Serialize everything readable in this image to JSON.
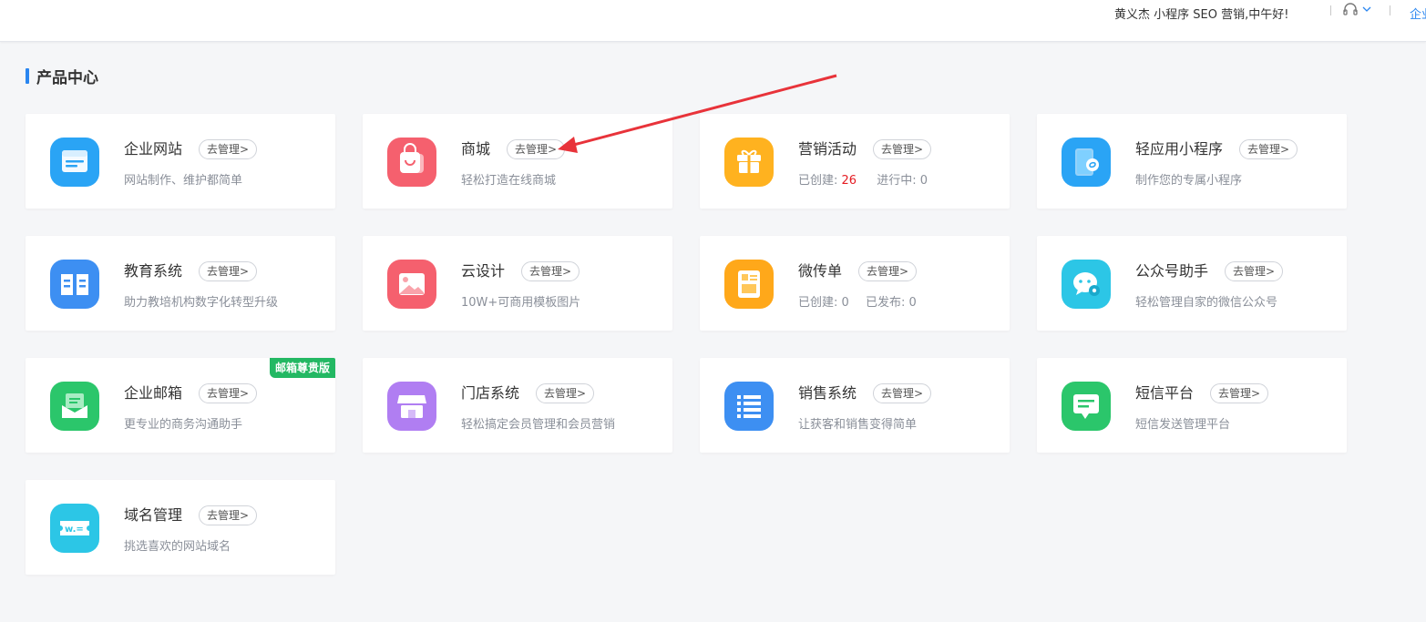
{
  "header": {
    "greeting": "黄义杰  小程序  SEO  营销,中午好!",
    "corp_link": "企业"
  },
  "section": {
    "title": "产品中心"
  },
  "cards": [
    {
      "name": "企业网站",
      "manage": "去管理>",
      "desc": "网站制作、维护都简单",
      "icon": "browser-window-icon",
      "color": "#2aa4f5"
    },
    {
      "name": "商城",
      "manage": "去管理>",
      "desc": "轻松打造在线商城",
      "icon": "shopping-bag-icon",
      "color": "#f5606e"
    },
    {
      "name": "营销活动",
      "manage": "去管理>",
      "stats": {
        "created_label": "已创建:",
        "created_value": "26",
        "active_label": "进行中:",
        "active_value": "0"
      },
      "icon": "gift-box-icon",
      "color": "#ffb21f"
    },
    {
      "name": "轻应用小程序",
      "manage": "去管理>",
      "desc": "制作您的专属小程序",
      "icon": "mini-program-phone-icon",
      "color": "#2aa4f5"
    },
    {
      "name": "教育系统",
      "manage": "去管理>",
      "desc": "助力教培机构数字化转型升级",
      "icon": "open-book-icon",
      "color": "#3d8ff2"
    },
    {
      "name": "云设计",
      "manage": "去管理>",
      "desc": "10W+可商用模板图片",
      "icon": "image-icon",
      "color": "#f5606e"
    },
    {
      "name": "微传单",
      "manage": "去管理>",
      "stats": {
        "created_label": "已创建:",
        "created_value": "0",
        "active_label": "已发布:",
        "active_value": "0"
      },
      "icon": "flyer-icon",
      "color": "#ffa81a"
    },
    {
      "name": "公众号助手",
      "manage": "去管理>",
      "desc": "轻松管理自家的微信公众号",
      "icon": "wechat-gear-icon",
      "color": "#2cc6e6"
    },
    {
      "name": "企业邮箱",
      "manage": "去管理>",
      "desc": "更专业的商务沟通助手",
      "badge": "邮箱尊贵版",
      "icon": "mail-envelope-icon",
      "color": "#2bc66b"
    },
    {
      "name": "门店系统",
      "manage": "去管理>",
      "desc": "轻松搞定会员管理和会员营销",
      "icon": "storefront-icon",
      "color": "#b07ef2"
    },
    {
      "name": "销售系统",
      "manage": "去管理>",
      "desc": "让获客和销售变得简单",
      "icon": "list-icon",
      "color": "#3d8ff2"
    },
    {
      "name": "短信平台",
      "manage": "去管理>",
      "desc": "短信发送管理平台",
      "icon": "sms-bubble-icon",
      "color": "#2bc66b"
    },
    {
      "name": "域名管理",
      "manage": "去管理>",
      "desc": "挑选喜欢的网站域名",
      "icon": "domain-ticket-icon",
      "color": "#2cc6e6"
    }
  ]
}
